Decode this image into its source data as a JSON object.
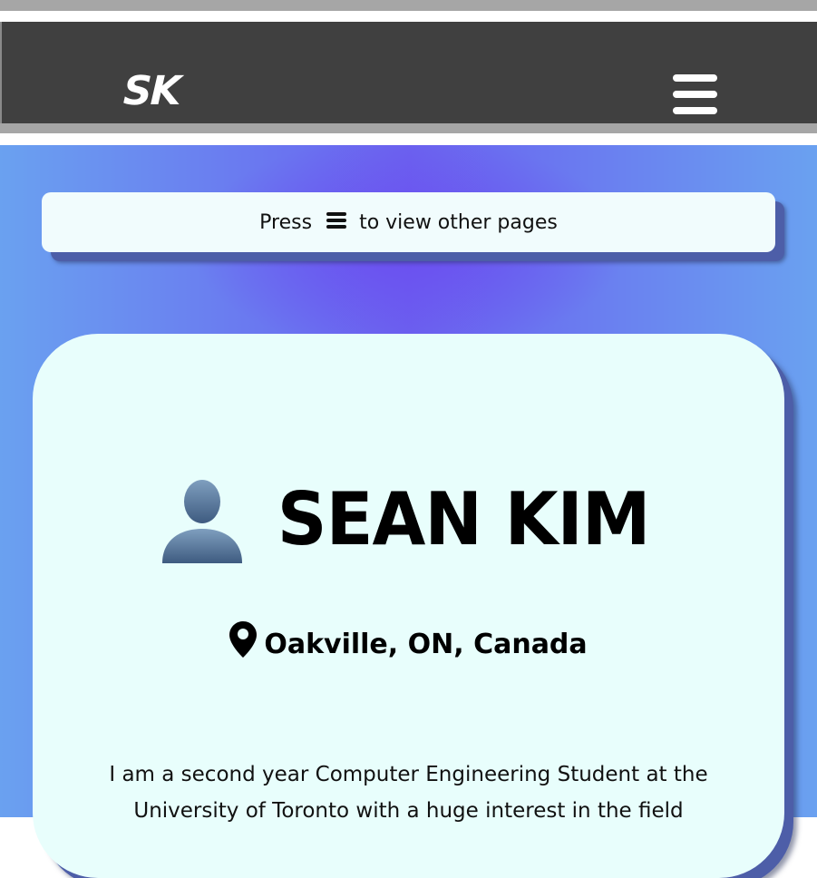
{
  "header": {
    "logo_text": "SK",
    "menu_icon": "hamburger-menu-icon"
  },
  "hint": {
    "prefix": "Press",
    "icon": "hamburger-menu-icon",
    "suffix": "to view other pages"
  },
  "profile": {
    "avatar_icon": "user-silhouette-icon",
    "name": "SEAN KIM",
    "location_icon": "map-pin-icon",
    "location": "Oakville, ON, Canada",
    "bio": "I am a second year Computer Engineering Student at the University of Toronto with a huge interest in the field"
  },
  "colors": {
    "navbar": "#404040",
    "strip": "#a6a6a6",
    "card": "#e8fefc",
    "hint_box": "#f1fcfd",
    "accent": "#6b4ef0"
  }
}
